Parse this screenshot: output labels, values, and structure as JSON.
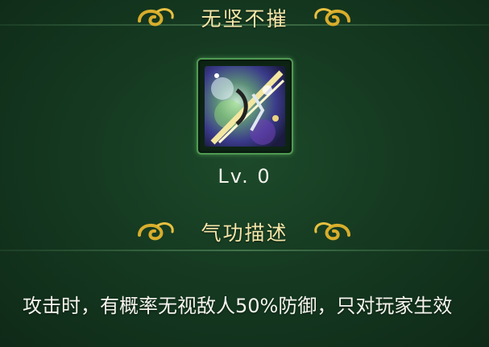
{
  "skill": {
    "title": "无坚不摧",
    "level": "Lv. 0",
    "icon": "sword-slash-skill-icon"
  },
  "description": {
    "heading": "气功描述",
    "text": "攻击时，有概率无视敌人50%防御，只对玩家生效"
  },
  "colors": {
    "background": "#153a21",
    "title_gold": "#f4e6a8",
    "ornament_gold": "#d8ad2c",
    "frame_green": "#4f9a52"
  }
}
